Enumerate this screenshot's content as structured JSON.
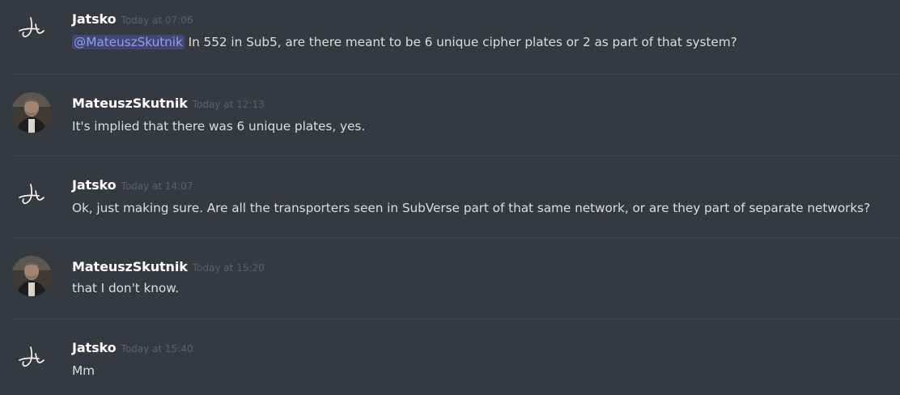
{
  "messages": [
    {
      "author": "Jatsko",
      "timestamp": "Today at 07:06",
      "avatar": "signature-glyph",
      "mention": "@MateuszSkutnik",
      "text": "In 552 in Sub5, are there meant to be 6 unique cipher plates or 2 as part of that system?"
    },
    {
      "author": "MateuszSkutnik",
      "timestamp": "Today at 12:13",
      "avatar": "photo",
      "text": "It's implied that there was 6 unique plates, yes."
    },
    {
      "author": "Jatsko",
      "timestamp": "Today at 14:07",
      "avatar": "signature-glyph",
      "text": "Ok, just making sure. Are all the transporters seen in SubVerse part of that same network, or are they part of separate networks?"
    },
    {
      "author": "MateuszSkutnik",
      "timestamp": "Today at 15:20",
      "avatar": "photo",
      "text": "that I don't know."
    },
    {
      "author": "Jatsko",
      "timestamp": "Today at 15:40",
      "avatar": "signature-glyph",
      "text": "Mm"
    }
  ],
  "colors": {
    "background": "#36393f",
    "divider": "#40444b",
    "username": "#ffffff",
    "timestamp": "#5d6067",
    "text": "#dcddde",
    "mention_bg": "#414675",
    "mention_fg": "#8ea1e1"
  }
}
